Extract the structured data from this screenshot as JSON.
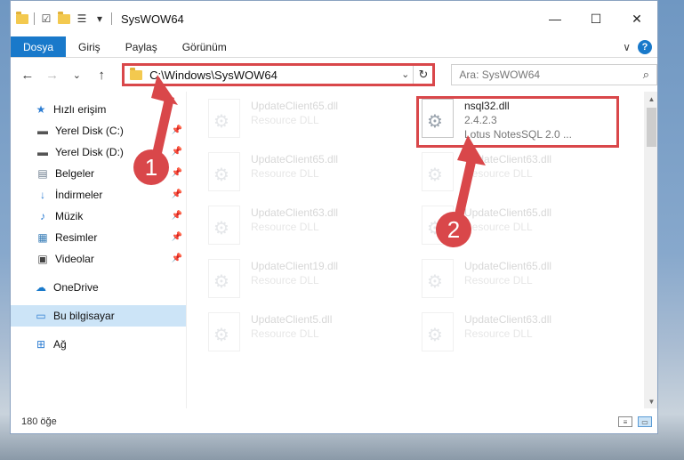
{
  "window": {
    "title": "SysWOW64",
    "controls": {
      "minimize": "—",
      "maximize": "☐",
      "close": "✕"
    }
  },
  "quick_access_toolbar": {
    "dropdown_glyph": "▾"
  },
  "ribbon": {
    "tabs": [
      "Dosya",
      "Giriş",
      "Paylaş",
      "Görünüm"
    ],
    "expand_glyph": "∨",
    "help_glyph": "?"
  },
  "nav": {
    "back": "←",
    "forward": "→",
    "recent": "⌄",
    "up": "↑",
    "address": "C:\\Windows\\SysWOW64",
    "address_dropdown": "⌄",
    "refresh": "↻",
    "search_placeholder": "Ara: SysWOW64",
    "search_glyph": "⌕"
  },
  "sidebar": {
    "quick_access": "Hızlı erişim",
    "items": [
      {
        "label": "Yerel Disk (C:)",
        "icon": "drive-icon"
      },
      {
        "label": "Yerel Disk (D:)",
        "icon": "drive-icon"
      },
      {
        "label": "Belgeler",
        "icon": "documents-icon"
      },
      {
        "label": "İndirmeler",
        "icon": "downloads-icon"
      },
      {
        "label": "Müzik",
        "icon": "music-icon"
      },
      {
        "label": "Resimler",
        "icon": "pictures-icon"
      },
      {
        "label": "Videolar",
        "icon": "videos-icon"
      }
    ],
    "onedrive": "OneDrive",
    "this_pc": "Bu bilgisayar",
    "network": "Ağ",
    "pin_glyph": "📌"
  },
  "files": {
    "left_column": [
      {
        "name": "UpdateClient65.dll",
        "sub": "Resource DLL"
      },
      {
        "name": "UpdateClient65.dll",
        "sub": "Resource DLL"
      },
      {
        "name": "UpdateClient63.dll",
        "sub": "Resource DLL"
      },
      {
        "name": "UpdateClient19.dll",
        "sub": "Resource DLL"
      },
      {
        "name": "UpdateClient5.dll",
        "sub": "Resource DLL"
      }
    ],
    "right_column": [
      {
        "name": "nsql32.dll",
        "version": "2.4.2.3",
        "sub": "Lotus NotesSQL 2.0 ..."
      },
      {
        "name": "UpdateClient63.dll",
        "sub": "Resource DLL"
      },
      {
        "name": "UpdateClient65.dll",
        "sub": "Resource DLL"
      },
      {
        "name": "UpdateClient65.dll",
        "sub": "Resource DLL"
      },
      {
        "name": "UpdateClient63.dll",
        "sub": "Resource DLL"
      }
    ]
  },
  "status": {
    "item_count": "180 öğe"
  },
  "annotations": {
    "step1": "1",
    "step2": "2",
    "accent_color": "#d9474a"
  }
}
